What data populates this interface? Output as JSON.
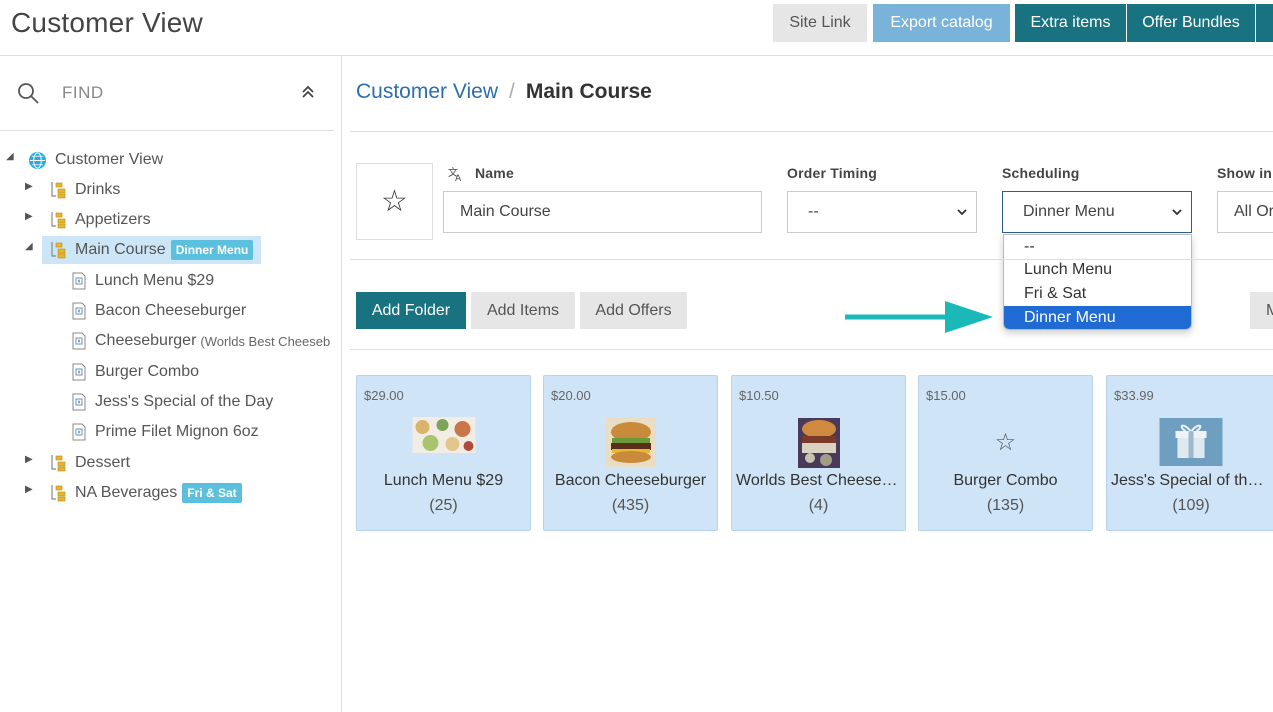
{
  "header": {
    "title": "Customer View",
    "buttons": {
      "site_link": "Site Link",
      "export_catalog": "Export catalog",
      "extra_items": "Extra items",
      "offer_bundles": "Offer Bundles"
    }
  },
  "sidebar": {
    "find_placeholder": "FIND",
    "tree": {
      "root": "Customer View",
      "drinks": "Drinks",
      "appetizers": "Appetizers",
      "main_course": "Main Course",
      "main_course_badge": "Dinner Menu",
      "children": {
        "c1": "Lunch Menu $29",
        "c2": "Bacon Cheeseburger",
        "c3": "Cheeseburger",
        "c3_sub": "(Worlds Best Cheeseb",
        "c4": "Burger Combo",
        "c5": "Jess's Special of the Day",
        "c6": "Prime Filet Mignon 6oz"
      },
      "dessert": "Dessert",
      "na_beverages": "NA Beverages",
      "na_badge": "Fri & Sat"
    }
  },
  "breadcrumb": {
    "link": "Customer View",
    "separator": "/",
    "current": "Main Course"
  },
  "form": {
    "name_label": "Name",
    "name_value": "Main Course",
    "order_timing_label": "Order Timing",
    "order_timing_value": "--",
    "scheduling_label": "Scheduling",
    "scheduling_value": "Dinner Menu",
    "show_in_label": "Show in C",
    "show_in_value": "All Or",
    "scheduling_options": {
      "o1": "--",
      "o2": "Lunch Menu",
      "o3": "Fri & Sat",
      "o4": "Dinner Menu"
    }
  },
  "actions": {
    "add_folder": "Add Folder",
    "add_items": "Add Items",
    "add_offers": "Add Offers",
    "more": "M"
  },
  "cards": {
    "c1": {
      "price": "$29.00",
      "title": "Lunch Menu $29",
      "count": "(25)"
    },
    "c2": {
      "price": "$20.00",
      "title": "Bacon Cheeseburger",
      "count": "(435)"
    },
    "c3": {
      "price": "$10.50",
      "title": "Worlds Best Cheeseburger",
      "count": "(4)"
    },
    "c4": {
      "price": "$15.00",
      "title": "Burger Combo",
      "count": "(135)"
    },
    "c5": {
      "price": "$33.99",
      "title": "Jess's Special of the Day",
      "count": "(109)"
    }
  },
  "colors": {
    "teal": "#187280",
    "light_blue_button": "#7ab3d9",
    "link_blue": "#2a6fb0",
    "badge": "#5bc0de",
    "card_bg": "#cfe4f6",
    "selected_option": "#1f6ad3",
    "arrow": "#1bb8b8"
  }
}
